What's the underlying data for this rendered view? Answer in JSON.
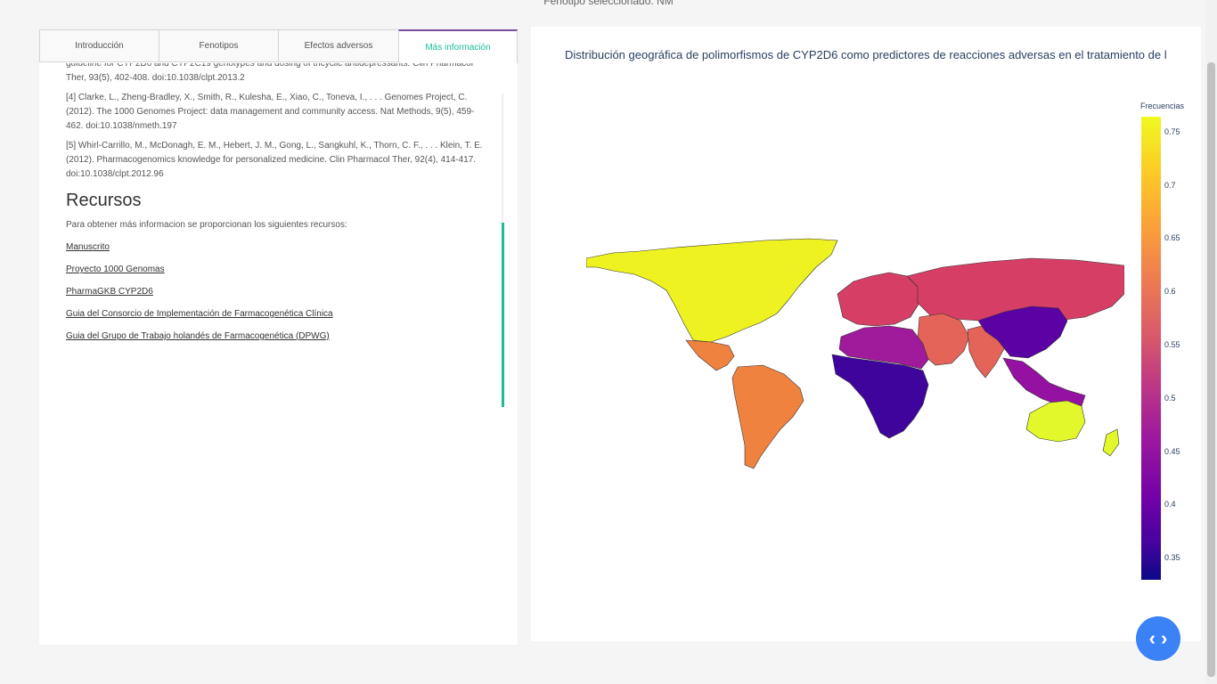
{
  "status": {
    "selected_phenotype": "Fenotipo seleccionado: NM"
  },
  "tabs": [
    {
      "label": "Introducción",
      "active": false
    },
    {
      "label": "Fenotipos",
      "active": false
    },
    {
      "label": "Efectos adversos",
      "active": false
    },
    {
      "label": "Más información",
      "active": true
    }
  ],
  "references": [
    "guideline for CYP2D6 and CYP2C19 genotypes and dosing of tricyclic antidepressants. Clin Pharmacol Ther, 93(5), 402-408. doi:10.1038/clpt.2013.2",
    "[4] Clarke, L., Zheng-Bradley, X., Smith, R., Kulesha, E., Xiao, C., Toneva, I., . . . Genomes Project, C. (2012). The 1000 Genomes Project: data management and community access. Nat Methods, 9(5), 459-462. doi:10.1038/nmeth.197",
    "[5] Whirl-Carrillo, M., McDonagh, E. M., Hebert, J. M., Gong, L., Sangkuhl, K., Thorn, C. F., . . . Klein, T. E. (2012). Pharmacogenomics knowledge for personalized medicine. Clin Pharmacol Ther, 92(4), 414-417. doi:10.1038/clpt.2012.96"
  ],
  "resources": {
    "title": "Recursos",
    "intro": "Para obtener más informacion se proporcionan los siguientes recursos:",
    "links": [
      "Manuscrito",
      "Proyecto 1000 Genomas",
      "PharmaGKB CYP2D6",
      "Guia del Consorcio de Implementación de Farmacogenética Clínica",
      "Guia del Grupo de Trabajo holandés de Farmacogenética (DPWG)"
    ]
  },
  "map": {
    "title": "Distribución geográfica de polimorfismos de CYP2D6 como predictores de reacciones adversas en el tratamiento de l",
    "colorbar_title": "Frecuencias",
    "colorbar_ticks": [
      "0.75",
      "0.7",
      "0.65",
      "0.6",
      "0.55",
      "0.5",
      "0.45",
      "0.4",
      "0.35"
    ],
    "colorbar_range": [
      0.33,
      0.765
    ],
    "regions": [
      {
        "name": "North America",
        "value": 0.75,
        "color": "#eef220"
      },
      {
        "name": "Central America",
        "value": 0.65,
        "color": "#f0823f"
      },
      {
        "name": "South America",
        "value": 0.65,
        "color": "#f0823f"
      },
      {
        "name": "Europe",
        "value": 0.56,
        "color": "#d63e66"
      },
      {
        "name": "Russia / Central Asia",
        "value": 0.56,
        "color": "#d63e66"
      },
      {
        "name": "Middle East",
        "value": 0.62,
        "color": "#e4645a"
      },
      {
        "name": "North Africa",
        "value": 0.47,
        "color": "#a01a9c"
      },
      {
        "name": "Sub-Saharan Africa",
        "value": 0.36,
        "color": "#3e049c"
      },
      {
        "name": "South Asia",
        "value": 0.62,
        "color": "#e4645a"
      },
      {
        "name": "East Asia",
        "value": 0.39,
        "color": "#5a02a3"
      },
      {
        "name": "Southeast Asia",
        "value": 0.45,
        "color": "#9511a1"
      },
      {
        "name": "Oceania",
        "value": 0.75,
        "color": "#e3f82a"
      }
    ]
  },
  "fab": {
    "icon": "code-icon",
    "label": "‹ ›"
  }
}
